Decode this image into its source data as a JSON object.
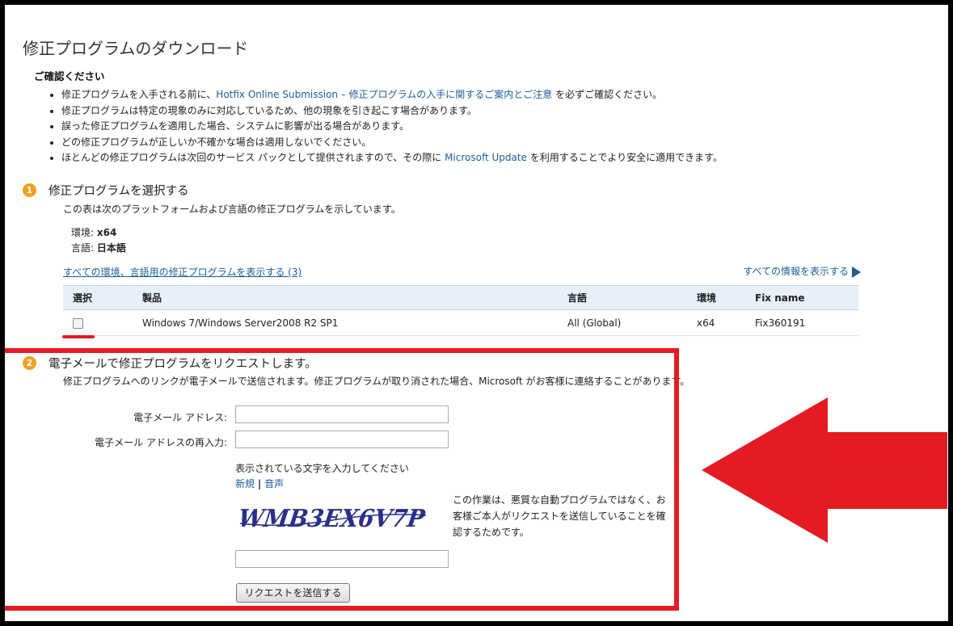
{
  "title": "修正プログラムのダウンロード",
  "confirm_heading": "ご確認ください",
  "notes": [
    {
      "pre": "修正プログラムを入手される前に、",
      "link": "Hotfix Online Submission – 修正プログラムの入手に関するご案内とご注意",
      "post": " を必ずご確認ください。"
    },
    {
      "pre": "修正プログラムは特定の現象のみに対応しているため、他の現象を引き起こす場合があります。"
    },
    {
      "pre": "誤った修正プログラムを適用した場合、システムに影響が出る場合があります。"
    },
    {
      "pre": "どの修正プログラムが正しいか不確かな場合は適用しないでください。"
    },
    {
      "pre": "ほとんどの修正プログラムは次回のサービス パックとして提供されますので、その際に ",
      "link": "Microsoft Update",
      "post": " を利用することでより安全に適用できます。"
    }
  ],
  "step1": {
    "number": "1",
    "heading": "修正プログラムを選択する",
    "desc": "この表は次のプラットフォームおよび言語の修正プログラムを示しています。",
    "env_label": "環境: ",
    "env_value": "x64",
    "lang_label": "言語: ",
    "lang_value": "日本語",
    "show_all_link": "すべての環境、言語用の修正プログラムを表示する (3)",
    "show_info_link": "すべての情報を表示する",
    "table": {
      "headers": [
        "選択",
        "製品",
        "言語",
        "環境",
        "Fix name"
      ],
      "row": {
        "product": "Windows 7/Windows Server2008 R2 SP1",
        "language": "All (Global)",
        "platform": "x64",
        "fix": "Fix360191"
      }
    }
  },
  "step2": {
    "number": "2",
    "heading": "電子メールで修正プログラムをリクエストします。",
    "desc": "修正プログラムへのリンクが電子メールで送信されます。修正プログラムが取り消された場合、Microsoft がお客様に連絡することがあります。",
    "email_label": "電子メール アドレス:",
    "email_confirm_label": "電子メール アドレスの再入力:",
    "captcha_prompt": "表示されている文字を入力してください",
    "captcha_new": "新規",
    "captcha_sep": "|",
    "captcha_audio": "音声",
    "captcha_text": "WMB3EX6V7P",
    "captcha_note": "この作業は、悪質な自動プログラムではなく、お客様ご本人がリクエストを送信していることを確認するためです。",
    "submit": "リクエストを送信する"
  },
  "colors": {
    "highlight": "#e51b24",
    "link": "#1a5e9a",
    "step_badge": "#f0a020"
  }
}
